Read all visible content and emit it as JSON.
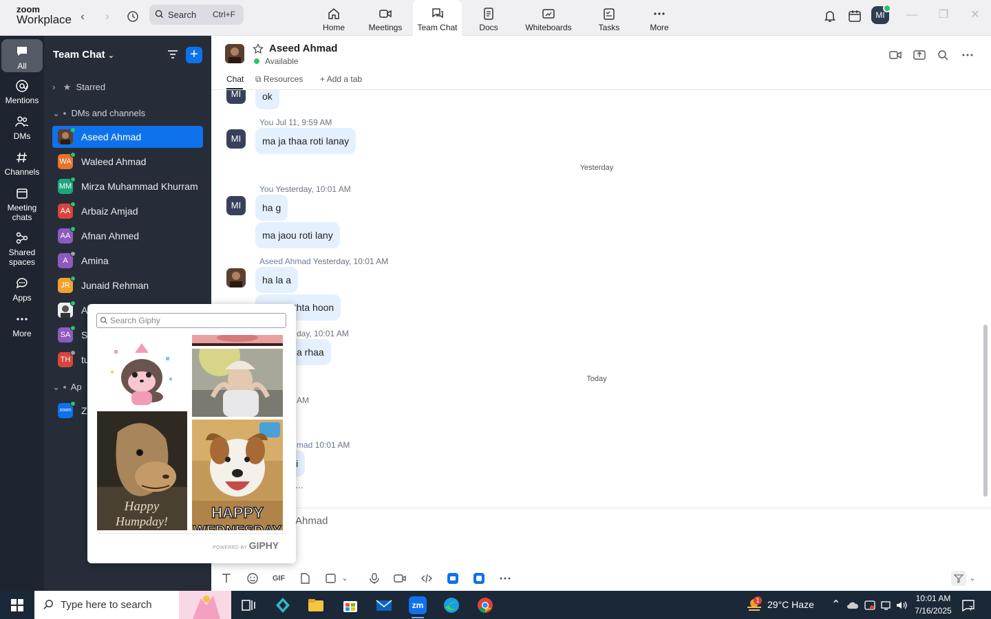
{
  "app": {
    "logo_line1": "zoom",
    "logo_line2": "Workplace"
  },
  "topbar": {
    "search_label": "Search",
    "search_shortcut": "Ctrl+F",
    "tabs": [
      {
        "label": "Home"
      },
      {
        "label": "Meetings"
      },
      {
        "label": "Team Chat"
      },
      {
        "label": "Docs"
      },
      {
        "label": "Whiteboards"
      },
      {
        "label": "Tasks"
      },
      {
        "label": "More"
      }
    ],
    "user_initials": "MI"
  },
  "rail": {
    "items": [
      {
        "label": "All"
      },
      {
        "label": "Mentions"
      },
      {
        "label": "DMs"
      },
      {
        "label": "Channels"
      },
      {
        "label_line1": "Meeting",
        "label_line2": "chats"
      },
      {
        "label_line1": "Shared",
        "label_line2": "spaces"
      },
      {
        "label": "Apps"
      },
      {
        "label": "More"
      }
    ]
  },
  "sidebar": {
    "title": "Team Chat",
    "sections": {
      "starred": "Starred",
      "dms": "DMs and channels",
      "apps": "Ap"
    },
    "contacts": [
      {
        "name": "Aseed Ahmad"
      },
      {
        "initials": "WA",
        "name": "Waleed Ahmad",
        "color": "#e8732c"
      },
      {
        "initials": "MM",
        "name": "Mirza Muhammad Khurram",
        "color": "#1fa67a"
      },
      {
        "initials": "AA",
        "name": "Arbaiz Amjad",
        "color": "#d9443b"
      },
      {
        "initials": "AA",
        "name": "Afnan Ahmed",
        "color": "#8d5bbf"
      },
      {
        "initials": "A",
        "name": "Amina",
        "color": "#8d5bbf"
      },
      {
        "initials": "JR",
        "name": "Junaid Rehman",
        "color": "#f2a22c"
      },
      {
        "name": "Al"
      },
      {
        "initials": "SA",
        "name": "Sa",
        "color": "#8d5bbf"
      },
      {
        "initials": "TH",
        "name": "tu",
        "color": "#d9443b"
      },
      {
        "initials": "zoom",
        "name": "Zo",
        "color": "#0e72ed"
      }
    ]
  },
  "chat": {
    "contact_name": "Aseed Ahmad",
    "status": "Available",
    "tabs": {
      "chat": "Chat",
      "resources": "Resources",
      "add": "Add a tab"
    },
    "messages": {
      "avatar": "MI",
      "m0": "ok",
      "s1_name": "You",
      "s1_time": "Jul 11, 9:59 AM",
      "m1": "ma ja thaa roti lanay",
      "day1": "Yesterday",
      "s2_name": "You",
      "s2_time": "Yesterday, 10:01 AM",
      "m2a": "ha g",
      "m2b": "ma jaou roti lany",
      "s3_name": "Aseed Ahmad",
      "s3_time": "Yesterday, 10:01 AM",
      "m3a": "ha la a",
      "m3b": "uthta hoon",
      "s4_time": "day, 10:01 AM",
      "m4": "a rhaa",
      "day2": "Today",
      "s5_time": "AM",
      "s6_name": "mad",
      "s6_time": "10:01 AM",
      "m6": "ji",
      "ellipsis": "..."
    },
    "composer_placeholder": "Ahmad",
    "gif_label": "GIF"
  },
  "giphy": {
    "search_placeholder": "Search Giphy",
    "gif1_caption_line1": "Happy",
    "gif1_caption_line2": "Humpday!",
    "gif2_caption_line1": "HAPPY",
    "gif2_caption_line2": "WEDNESDAY",
    "powered": "POWERED BY",
    "brand": "GIPHY"
  },
  "taskbar": {
    "search_placeholder": "Type here to search",
    "weather": "29°C  Haze",
    "time": "10:01 AM",
    "date": "7/16/2025",
    "notif_count": "7",
    "badge": "1"
  },
  "colors": {
    "accent": "#0e72ed",
    "sidebar": "#262d39",
    "rail": "#1e2530",
    "bubble": "#e5f0ff",
    "online": "#2bc36b"
  }
}
